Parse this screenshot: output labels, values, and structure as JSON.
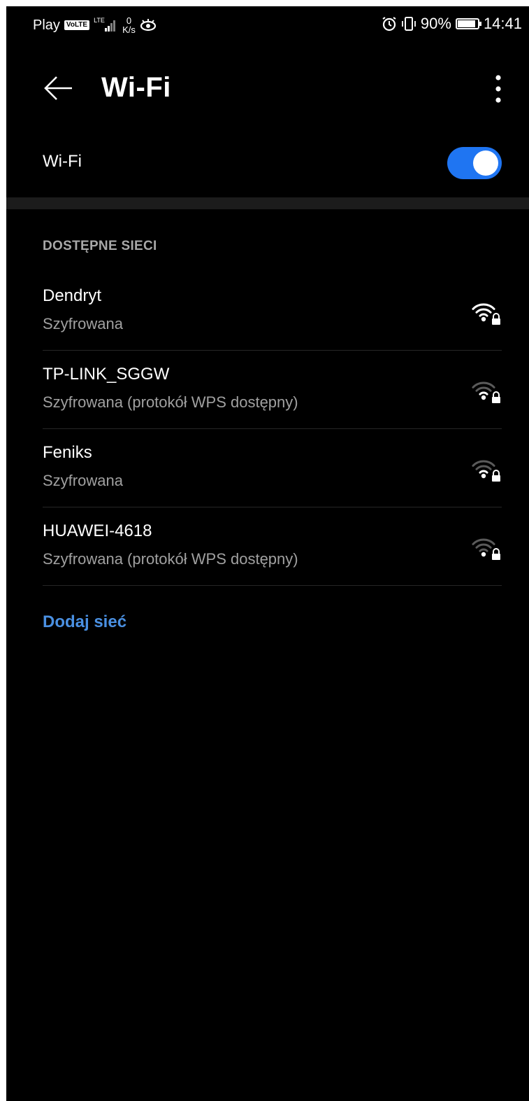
{
  "status_bar": {
    "carrier": "Play",
    "volte": "VoLTE",
    "lte": "LTE",
    "net_speed_value": "0",
    "net_speed_unit": "K/s",
    "battery_percent": "90%",
    "battery_level": 0.9,
    "time": "14:41"
  },
  "app_bar": {
    "title": "Wi-Fi"
  },
  "wifi_toggle": {
    "label": "Wi-Fi",
    "on": true,
    "accent_color": "#1f75f2"
  },
  "section": {
    "header": "DOSTĘPNE SIECI"
  },
  "networks": [
    {
      "name": "Dendryt",
      "status": "Szyfrowana",
      "signal": 4
    },
    {
      "name": "TP-LINK_SGGW",
      "status": "Szyfrowana (protokół WPS dostępny)",
      "signal": 2
    },
    {
      "name": "Feniks",
      "status": "Szyfrowana",
      "signal": 2
    },
    {
      "name": "HUAWEI-4618",
      "status": "Szyfrowana (protokół WPS dostępny)",
      "signal": 1
    }
  ],
  "add_network": {
    "label": "Dodaj sieć",
    "color": "#4a90e2"
  },
  "icons": {
    "back": "arrow-left-icon",
    "menu": "more-vertical-icon",
    "wifi_secured": "wifi-lock-icon",
    "alarm": "alarm-icon",
    "vibrate": "vibrate-icon",
    "eye": "eye-comfort-icon"
  }
}
